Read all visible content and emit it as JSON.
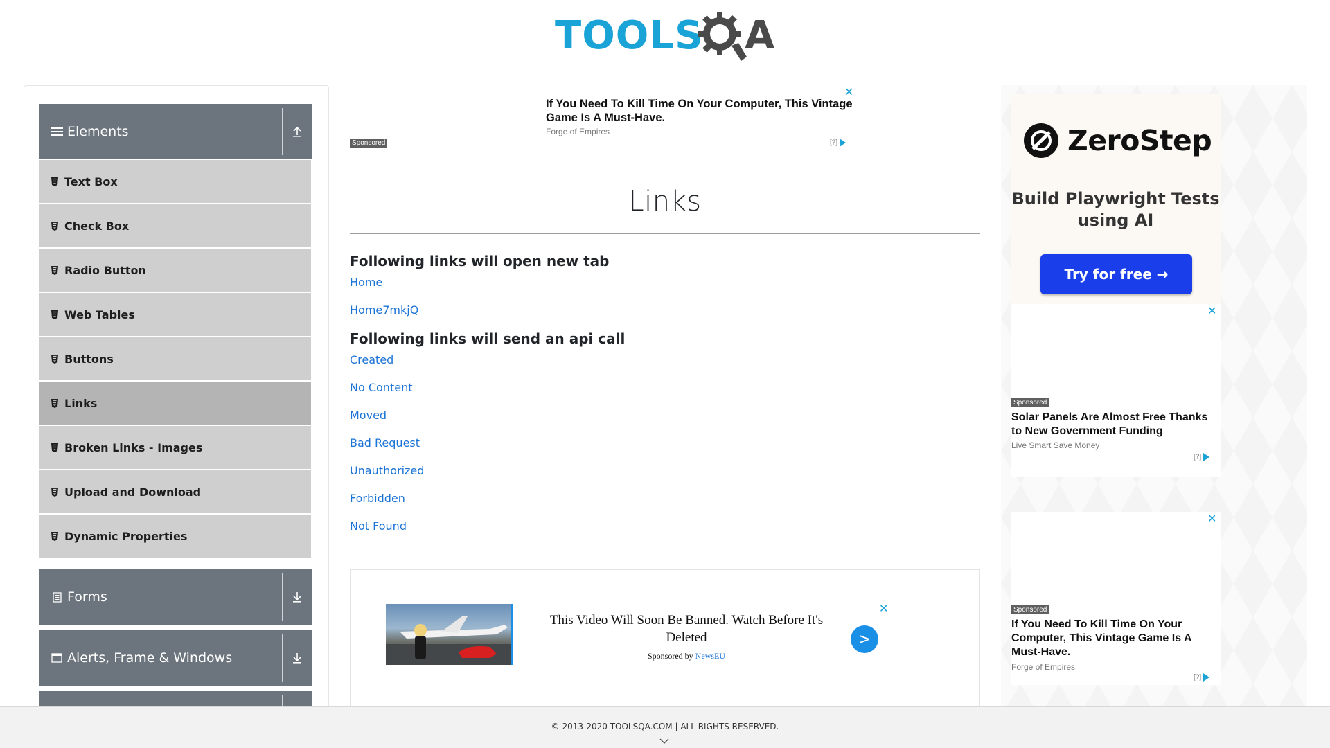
{
  "header": {
    "logo_tools": "TOOLS",
    "logo_a": "A",
    "brand_colors": {
      "tools": "#1aa3d6",
      "qa": "#4a4a4a"
    }
  },
  "sidebar": {
    "groups": [
      {
        "label": "Elements",
        "icon": "hamburger-icon",
        "state": "expanded",
        "arrow": "collapse-arrow-icon"
      },
      {
        "label": "Forms",
        "icon": "document-icon",
        "state": "collapsed",
        "arrow": "expand-arrow-icon"
      },
      {
        "label": "Alerts, Frame & Windows",
        "icon": "window-icon",
        "state": "collapsed",
        "arrow": "expand-arrow-icon"
      }
    ],
    "items": [
      {
        "label": "Text Box"
      },
      {
        "label": "Check Box"
      },
      {
        "label": "Radio Button"
      },
      {
        "label": "Web Tables"
      },
      {
        "label": "Buttons"
      },
      {
        "label": "Links",
        "active": true
      },
      {
        "label": "Broken Links - Images"
      },
      {
        "label": "Upload and Download"
      },
      {
        "label": "Dynamic Properties"
      }
    ]
  },
  "ads": {
    "top": {
      "title": "If You Need To Kill Time On Your Computer, This Vintage Game Is A Must-Have.",
      "source": "Forge of Empires",
      "sponsored": "Sponsored",
      "close": "✕",
      "choice": "[?]"
    },
    "bottom": {
      "text": "This Video Will Soon Be Banned. Watch Before It's Deleted",
      "by_prefix": "Sponsored by ",
      "by_brand": "NewsEU",
      "go": ">",
      "close": "✕"
    },
    "right": {
      "zerostep": {
        "name": "ZeroStep",
        "tagline": "Build Playwright Tests using AI",
        "button": "Try for free →"
      },
      "ad1": {
        "sponsored": "Sponsored",
        "title": "Solar Panels Are Almost Free Thanks to New Government Funding",
        "source": "Live Smart Save Money",
        "close": "✕",
        "choice": "[?]"
      },
      "ad2": {
        "sponsored": "Sponsored",
        "title": "If You Need To Kill Time On Your Computer, This Vintage Game Is A Must-Have.",
        "source": "Forge of Empires",
        "close": "✕",
        "choice": "[?]"
      }
    }
  },
  "main": {
    "title": "Links",
    "section_new_tab": "Following links will open new tab",
    "new_tab_links": [
      "Home",
      "Home7mkjQ"
    ],
    "section_api": "Following links will send an api call",
    "api_links": [
      "Created",
      "No Content",
      "Moved",
      "Bad Request",
      "Unauthorized",
      "Forbidden",
      "Not Found"
    ],
    "link_color": "#1b73d6"
  },
  "footer": {
    "copyright": "© 2013-2020 TOOLSQA.COM | ALL RIGHTS RESERVED."
  }
}
